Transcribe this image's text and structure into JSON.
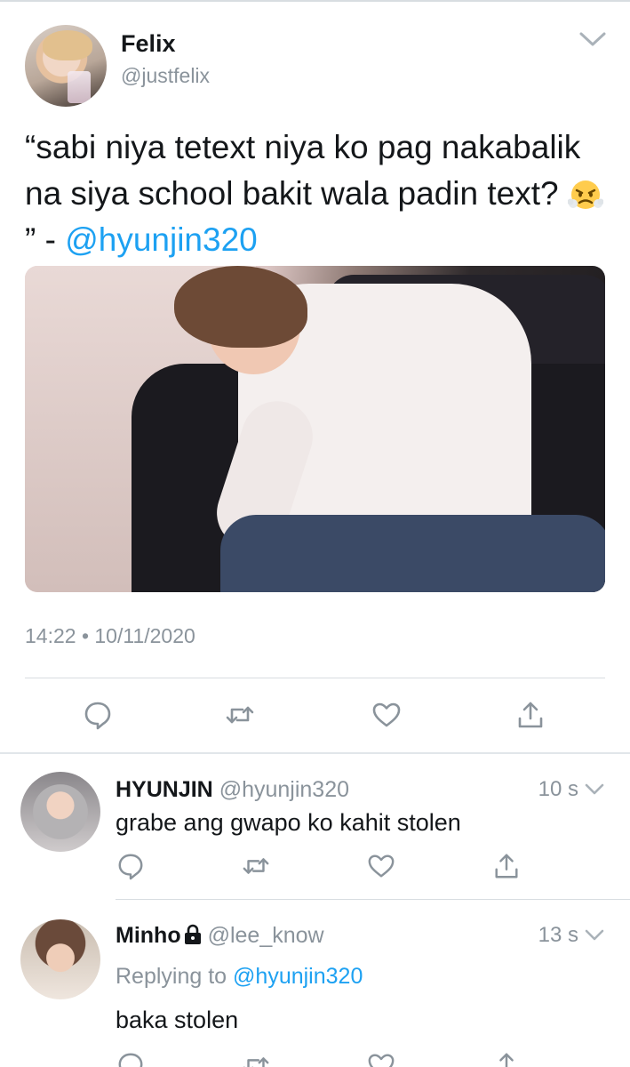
{
  "main_tweet": {
    "author": {
      "name": "Felix",
      "handle": "@justfelix"
    },
    "text_before": "“sabi niya tetext niya ko pag nakabalik na siya school bakit wala padin text? ",
    "text_emoji": "face-with-steam-from-nose",
    "text_after": "” - ",
    "text_mention": "@hyunjin320",
    "timestamp": "14:22 • 10/11/2020",
    "actions": [
      "reply-icon",
      "retweet-icon",
      "like-icon",
      "share-icon"
    ]
  },
  "replies": [
    {
      "name": "HYUNJIN",
      "handle": "@hyunjin320",
      "time": "10 s",
      "replying_label": "",
      "replying_to": "",
      "text": "grabe ang gwapo ko kahit stolen"
    },
    {
      "name": "Minho",
      "handle": "@lee_know",
      "protected": true,
      "time": "13 s",
      "replying_label": "Replying to",
      "replying_to": "@hyunjin320",
      "text": "baka stolen"
    }
  ],
  "colors": {
    "accent": "#1da1f2",
    "muted": "#8a939b",
    "text": "#14171a",
    "divider": "#d8dde1"
  }
}
